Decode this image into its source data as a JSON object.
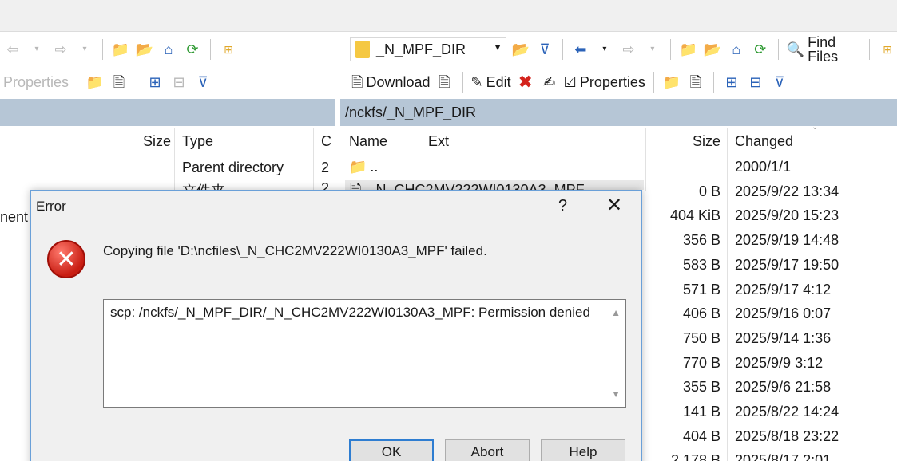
{
  "left_toolbar1": {
    "back_icon": "back-arrow-icon",
    "forward_icon": "forward-arrow-icon"
  },
  "left_toolbar2": {
    "properties_label": "Properties"
  },
  "right_path": {
    "current": "_N_MPF_DIR"
  },
  "right_toolbar1": {
    "find_files_label": "Find Files"
  },
  "right_toolbar2": {
    "download_label": "Download",
    "edit_label": "Edit",
    "properties_label": "Properties"
  },
  "right_panel": {
    "path": "/nckfs/_N_MPF_DIR"
  },
  "left_panel": {
    "columns": {
      "size": "Size",
      "type": "Type",
      "changed_trunc": "C"
    },
    "rows": [
      {
        "type": "Parent directory",
        "changed_trunc": "2"
      },
      {
        "type": "文件夹",
        "changed_trunc": "2"
      }
    ],
    "cut_off_text": "nent"
  },
  "right_columns": {
    "name": "Name",
    "ext": "Ext",
    "size": "Size",
    "changed": "Changed"
  },
  "right_rows": [
    {
      "name": "..",
      "size": "",
      "changed": "2000/1/1"
    },
    {
      "name": "_N_CHC2MV222WI0130A3_MPF",
      "size": "0 B",
      "changed": "2025/9/22 13:34"
    },
    {
      "name": "",
      "size": "404 KiB",
      "changed": "2025/9/20 15:23"
    },
    {
      "name": "",
      "size": "356 B",
      "changed": "2025/9/19 14:48"
    },
    {
      "name": "",
      "size": "583 B",
      "changed": "2025/9/17 19:50"
    },
    {
      "name": "",
      "size": "571 B",
      "changed": "2025/9/17 4:12"
    },
    {
      "name": "",
      "size": "406 B",
      "changed": "2025/9/16 0:07"
    },
    {
      "name": "",
      "size": "750 B",
      "changed": "2025/9/14 1:36"
    },
    {
      "name": "",
      "size": "770 B",
      "changed": "2025/9/9 3:12"
    },
    {
      "name": "",
      "size": "355 B",
      "changed": "2025/9/6 21:58"
    },
    {
      "name": "",
      "size": "141 B",
      "changed": "2025/8/22 14:24"
    },
    {
      "name": "",
      "size": "404 B",
      "changed": "2025/8/18 23:22"
    },
    {
      "name": "",
      "size": "2,178 B",
      "changed": "2025/8/17 2:01"
    }
  ],
  "dialog": {
    "title": "Error",
    "help_glyph": "?",
    "close_glyph": "✕",
    "message": "Copying file 'D:\\ncfiles\\_N_CHC2MV222WI0130A3_MPF' failed.",
    "detail": "scp: /nckfs/_N_MPF_DIR/_N_CHC2MV222WI0130A3_MPF: Permission denied",
    "buttons": {
      "ok": "OK",
      "abort": "Abort",
      "help": "Help"
    }
  }
}
